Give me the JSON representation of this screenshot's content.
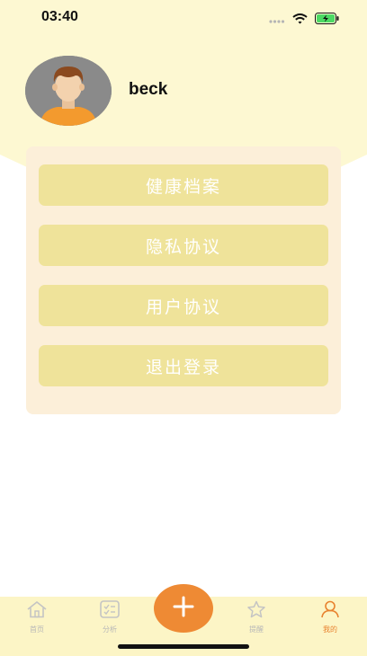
{
  "status_bar": {
    "time": "03:40"
  },
  "profile": {
    "username": "beck"
  },
  "menu": {
    "items": [
      {
        "label": "健康档案"
      },
      {
        "label": "隐私协议"
      },
      {
        "label": "用户协议"
      },
      {
        "label": "退出登录"
      }
    ]
  },
  "tab_bar": {
    "tabs": [
      {
        "label": "首页",
        "icon": "home-icon",
        "active": false
      },
      {
        "label": "分析",
        "icon": "checklist-icon",
        "active": false
      },
      {
        "label": "提醒",
        "icon": "star-icon",
        "active": false
      },
      {
        "label": "我的",
        "icon": "person-icon",
        "active": true
      }
    ],
    "fab_icon": "plus-icon"
  },
  "colors": {
    "header_bg": "#fdf8d2",
    "card_bg": "#fcefd9",
    "button_bg": "#efe39a",
    "accent": "#ee8a34",
    "tab_bar_bg": "#fcf5c6"
  }
}
